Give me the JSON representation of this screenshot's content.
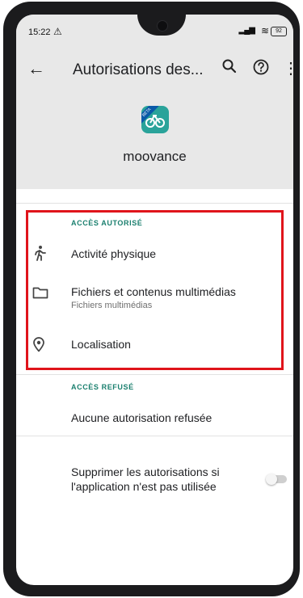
{
  "status_bar": {
    "time": "15:22",
    "battery": "92"
  },
  "app_bar": {
    "title": "Autorisations des..."
  },
  "app": {
    "name": "moovance",
    "icon_badge": "BETA"
  },
  "allowed": {
    "title": "ACCÈS AUTORISÉ",
    "items": [
      {
        "label": "Activité physique",
        "icon": "running-person-icon"
      },
      {
        "label": "Fichiers et contenus multimédias",
        "sub": "Fichiers multimédias",
        "icon": "folder-icon"
      },
      {
        "label": "Localisation",
        "icon": "location-pin-icon"
      }
    ]
  },
  "denied": {
    "title": "ACCÈS REFUSÉ",
    "empty": "Aucune autorisation refusée"
  },
  "remove_permissions": {
    "line1": "Supprimer les autorisations si",
    "line2": "l'application n'est pas utilisée",
    "enabled": false
  },
  "colors": {
    "accent": "#1a7f6e",
    "highlight": "#e0141b",
    "app_icon": "#2aa39a"
  }
}
